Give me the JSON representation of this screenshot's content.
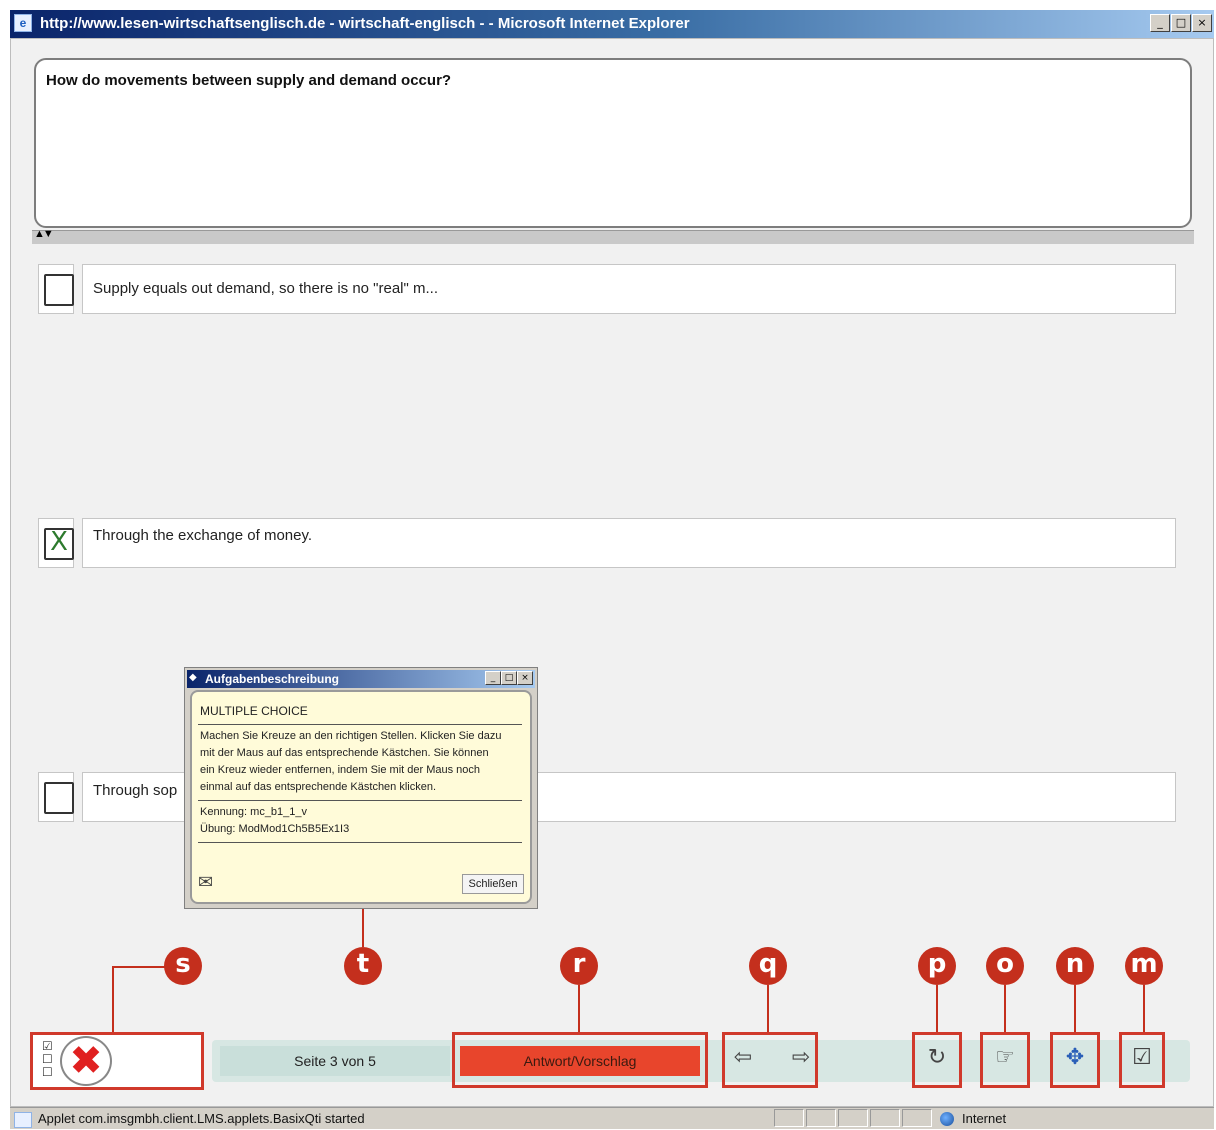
{
  "window": {
    "title": "http://www.lesen-wirtschaftsenglisch.de - wirtschaft-englisch - - Microsoft Internet Explorer",
    "minimize": "_",
    "maximize": "□",
    "close": "×"
  },
  "question": {
    "text": "How do movements between supply and demand occur?",
    "splitter_arrows": "▲▼"
  },
  "answers": [
    {
      "text": "Supply equals out demand, so there is no \"real\" m...",
      "checked": false
    },
    {
      "text": "Through the exchange of money.",
      "checked": true,
      "mark": "X"
    },
    {
      "text": "Through sop",
      "checked": false
    }
  ],
  "dialog": {
    "title": "Aufgabenbeschreibung",
    "type": "MULTIPLE CHOICE",
    "instructions": [
      "Machen Sie Kreuze an den richtigen Stellen. Klicken Sie dazu",
      "mit der Maus auf das entsprechende Kästchen. Sie können",
      "ein Kreuz wieder entfernen, indem Sie mit der Maus noch",
      "einmal auf das entsprechende Kästchen klicken."
    ],
    "id_line": "Kennung: mc_b1_1_v",
    "exercise_line": "Übung: ModMod1Ch5B5Ex1I3",
    "close_label": "Schließen",
    "mail_icon": "✉"
  },
  "callouts": [
    "s",
    "t",
    "r",
    "q",
    "p",
    "o",
    "n",
    "m"
  ],
  "toolbar": {
    "page_label": "Seite 3 von 5",
    "answer_label": "Antwort/Vorschlag",
    "prev_icon": "⇦",
    "next_icon": "⇨",
    "reset_icon": "↻",
    "hint_icon": "☞",
    "group_icon": "✥",
    "check_icon": "☑",
    "menu_icon": "☑\n☐\n☐",
    "logo_icon": "✖"
  },
  "status": {
    "text": "Applet com.imsgmbh.client.LMS.applets.BasixQti started",
    "zone": "Internet"
  },
  "colors": {
    "accent_red": "#c42f1d",
    "answer_button": "#e8452c",
    "toolbar_bg": "#d7e7e3",
    "dialog_bg": "#fffbd9"
  }
}
